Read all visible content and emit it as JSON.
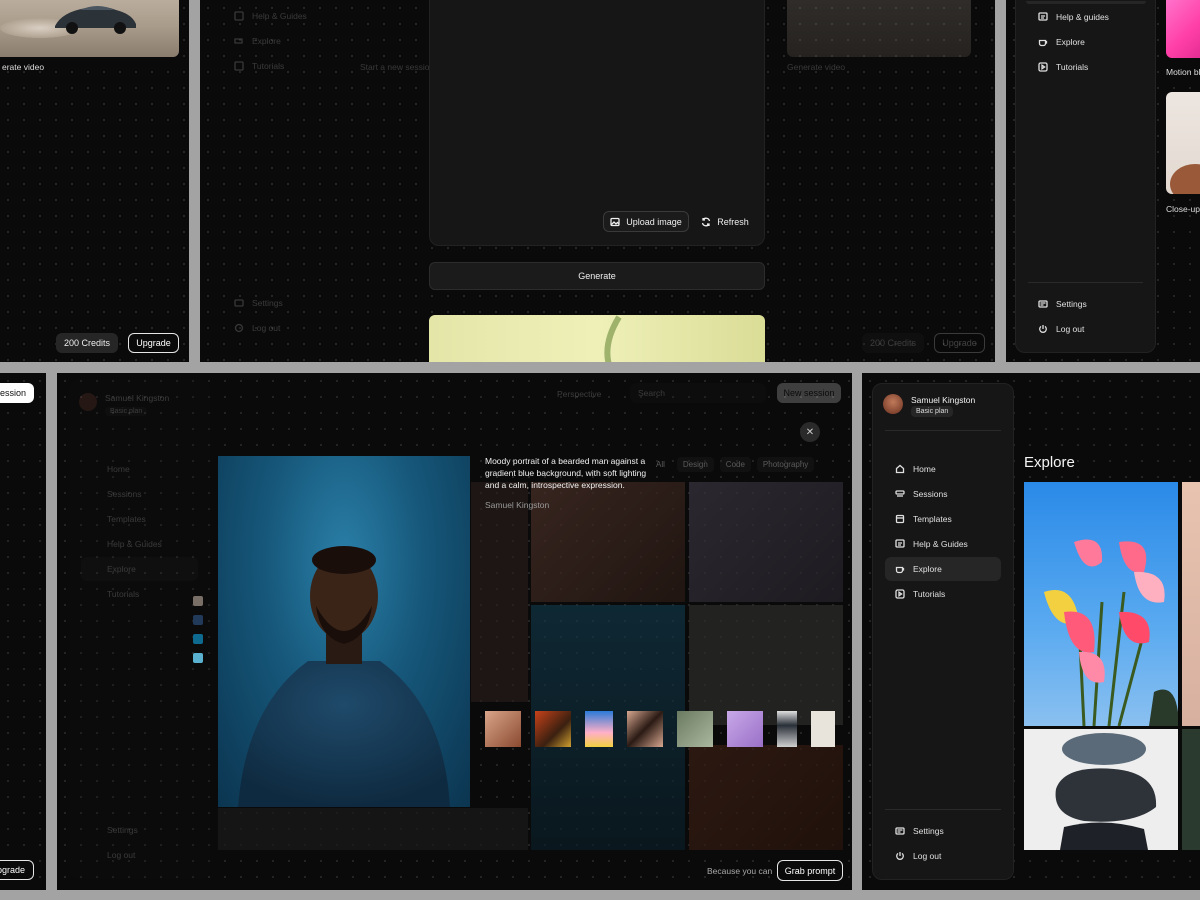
{
  "panel1": {
    "caption": "erate video",
    "credits_label": "200 Credits",
    "upgrade_label": "Upgrade"
  },
  "panel2": {
    "nav": [
      "Help & Guides",
      "Explore",
      "Tutorials"
    ],
    "settings_label": "Settings",
    "logout_label": "Log out",
    "session_hint": "Start a new session",
    "upload_label": "Upload image",
    "refresh_label": "Refresh",
    "generate_label": "Generate",
    "right_caption": "Generate video",
    "credits_label": "200 Credits",
    "upgrade_label": "Upgrade"
  },
  "panel3": {
    "nav": [
      "Help & guides",
      "Explore",
      "Tutorials"
    ],
    "settings_label": "Settings",
    "logout_label": "Log out",
    "caption_top": "Motion bl",
    "caption_bottom": "Close-up"
  },
  "panel4": {
    "session_label": "session",
    "upgrade_label": "pgrade"
  },
  "panel5": {
    "user_name": "Samuel Kingston",
    "plan": "Basic plan",
    "nav": [
      "Home",
      "Sessions",
      "Templates",
      "Help & Guides",
      "Explore",
      "Tutorials"
    ],
    "settings_label": "Settings",
    "logout_label": "Log out",
    "perspective_label": "Perspective",
    "search_placeholder": "Search",
    "new_session_label": "New session",
    "filters": [
      "All",
      "Design",
      "Code",
      "Photography"
    ],
    "modal": {
      "description": "Moody portrait of a bearded man against a gradient blue background, with soft lighting and a calm, introspective expression.",
      "author": "Samuel Kingston",
      "footer_note": "Because you can",
      "grab_label": "Grab prompt",
      "swatches": [
        "#7a6f66",
        "#223a5a",
        "#0e6a8e",
        "#5ab2d0"
      ]
    }
  },
  "panel6": {
    "user_name": "Samuel Kingston",
    "plan": "Basic plan",
    "nav": [
      "Home",
      "Sessions",
      "Templates",
      "Help & Guides",
      "Explore",
      "Tutorials"
    ],
    "active_nav": "Explore",
    "settings_label": "Settings",
    "logout_label": "Log out",
    "page_title": "Explore"
  },
  "colors": {
    "frame": "#a3a3a3",
    "panel_bg": "#0a0a0a",
    "card_bg": "#161616",
    "active_bg": "#262626"
  }
}
